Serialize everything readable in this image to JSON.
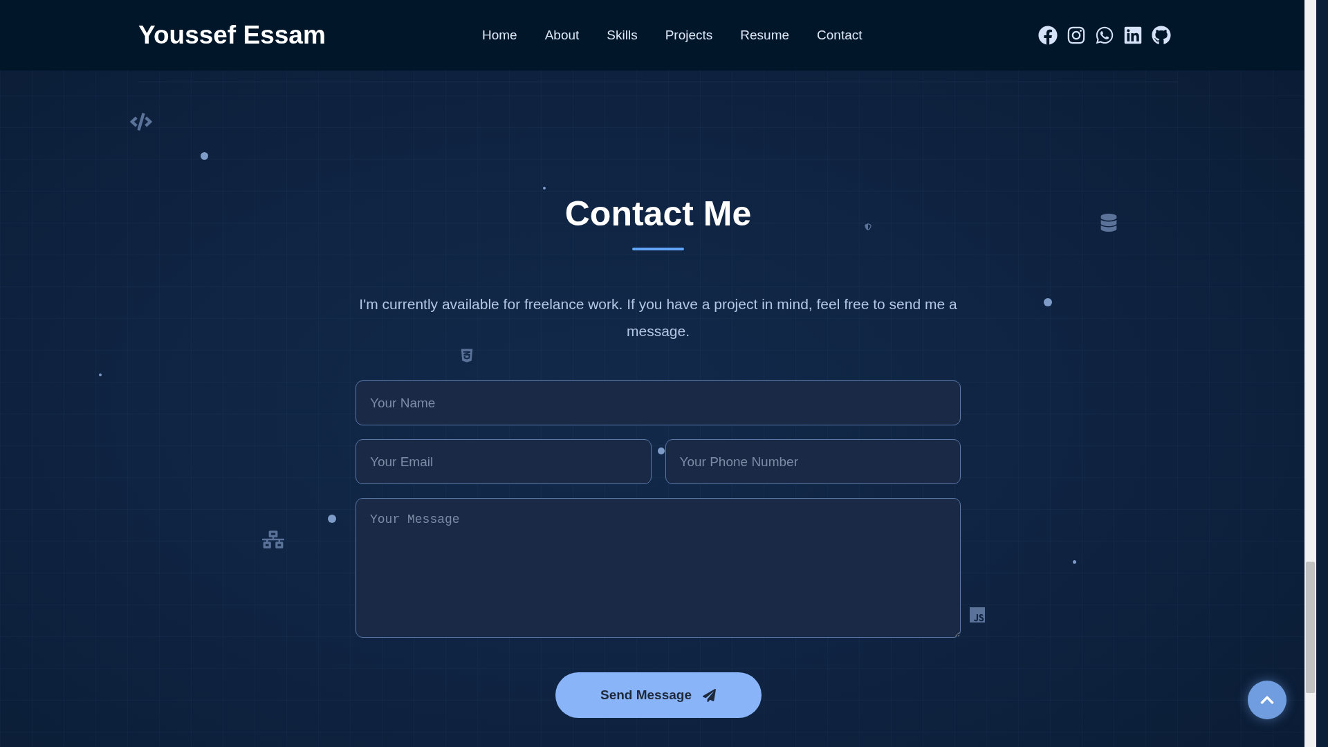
{
  "header": {
    "logo": "Youssef Essam",
    "nav": [
      "Home",
      "About",
      "Skills",
      "Projects",
      "Resume",
      "Contact"
    ]
  },
  "contact": {
    "title": "Contact Me",
    "intro": "I'm currently available for freelance work. If you have a project in mind, feel free to send me a message.",
    "fields": [
      {
        "kind": "input",
        "placeholder": "Your Name"
      },
      {
        "kind": "input",
        "placeholder": "Your Email"
      },
      {
        "kind": "input",
        "placeholder": "Your Phone Number"
      },
      {
        "kind": "textarea",
        "placeholder": "Your Message"
      }
    ],
    "submit": "Send Message"
  }
}
